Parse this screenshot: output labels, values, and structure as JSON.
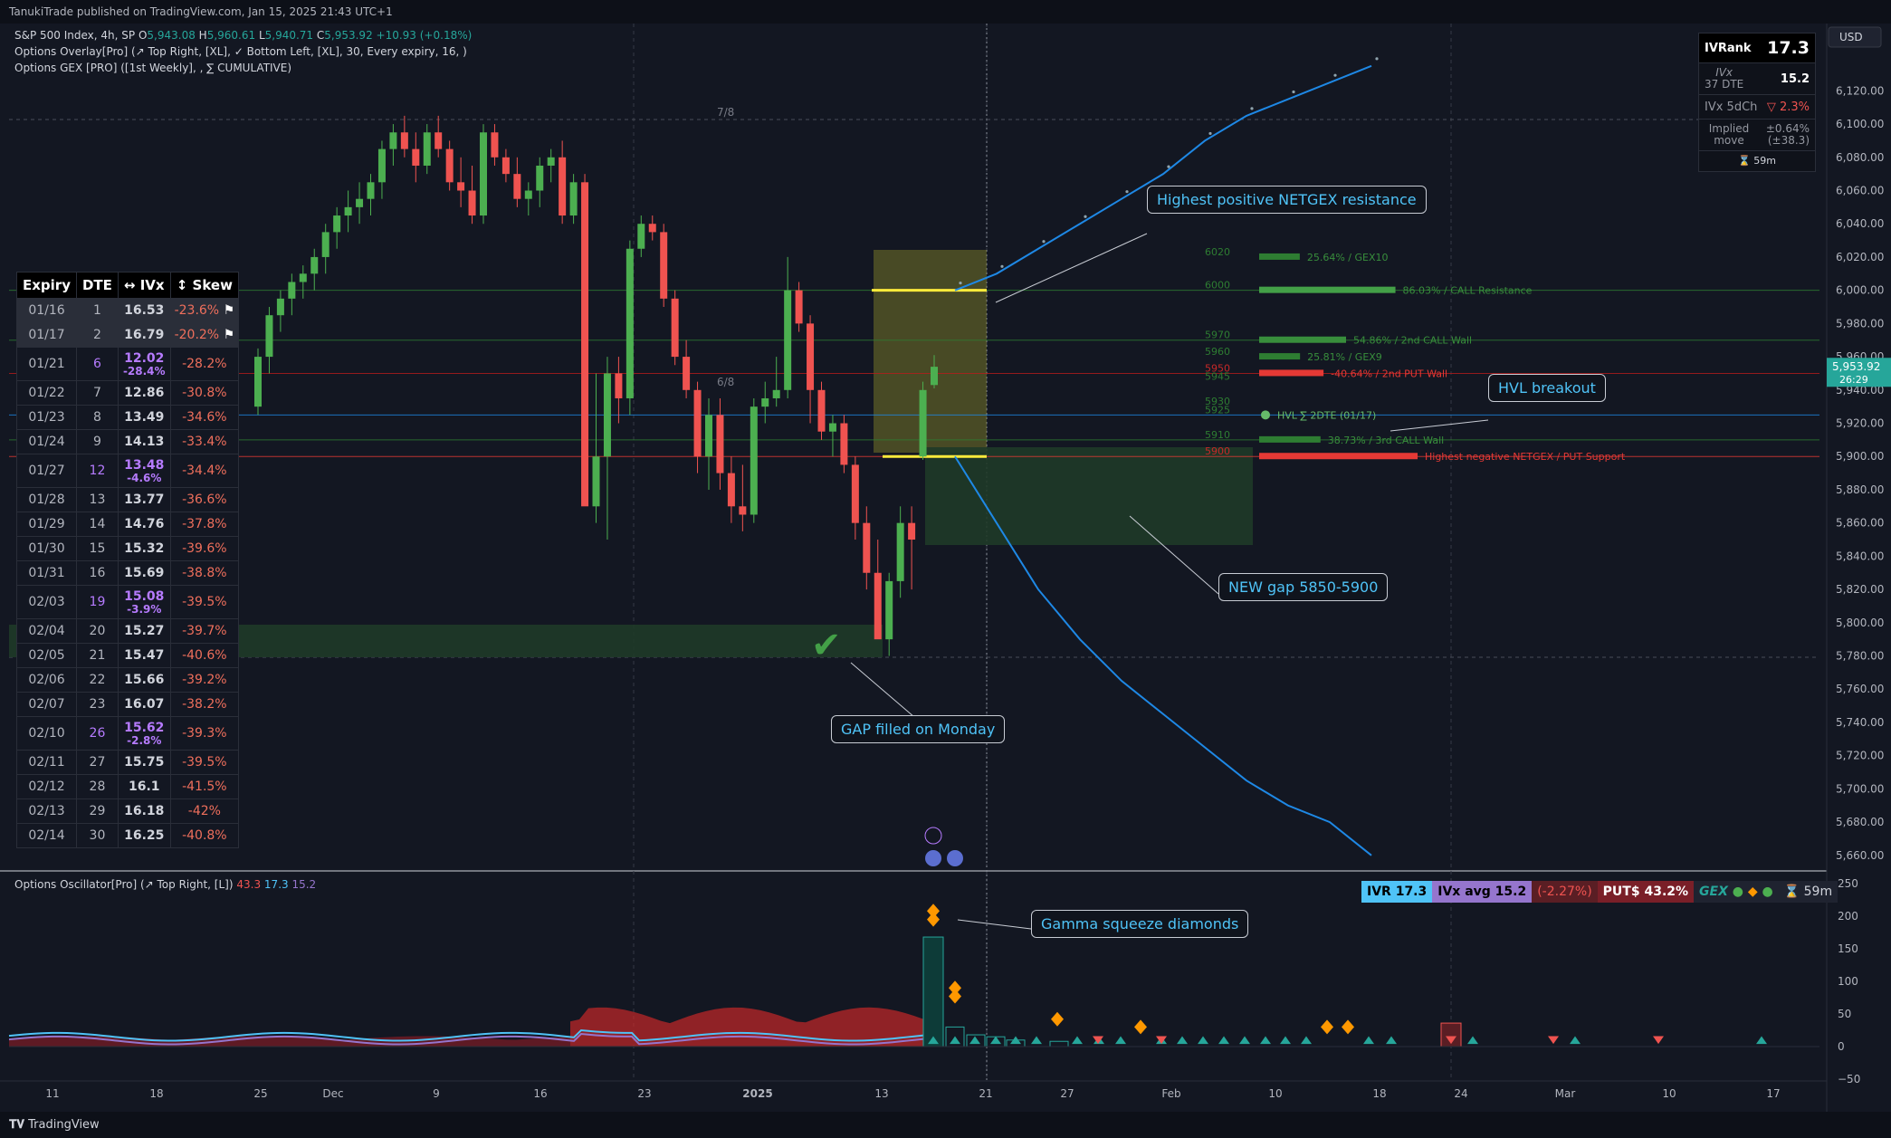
{
  "header": {
    "published": "TanukiTrade published on TradingView.com, Jan 15, 2025 21:43 UTC+1",
    "symbol": "S&P 500 Index, 4h, SP",
    "ohlc": {
      "o": "5,943.08",
      "h": "5,960.61",
      "l": "5,940.71",
      "c": "5,953.92",
      "change": "+10.93 (+0.18%)"
    },
    "overlay_line": "Options Overlay[Pro] (↗ Top Right, [XL], ✓ Bottom Left, [XL], 30, Every expiry, 16, )",
    "gex_line": "Options GEX [PRO] ([1st Weekly], , ∑ CUMULATIVE)"
  },
  "price_axis": {
    "currency": "USD",
    "ticks": [
      "6,120.00",
      "6,100.00",
      "6,080.00",
      "6,060.00",
      "6,040.00",
      "6,020.00",
      "6,000.00",
      "5,980.00",
      "5,960.00",
      "5,940.00",
      "5,920.00",
      "5,900.00",
      "5,880.00",
      "5,860.00",
      "5,840.00",
      "5,820.00",
      "5,800.00",
      "5,780.00",
      "5,760.00",
      "5,740.00",
      "5,720.00",
      "5,700.00",
      "5,680.00",
      "5,660.00"
    ],
    "current_price": "5,953.92",
    "countdown": "26:29"
  },
  "time_axis": {
    "labels": [
      "11",
      "18",
      "25",
      "Dec",
      "9",
      "16",
      "23",
      "2025",
      "13",
      "21",
      "27",
      "Feb",
      "10",
      "18",
      "24",
      "Mar",
      "10",
      "17"
    ]
  },
  "chart_data": {
    "type": "candlestick",
    "title": "S&P 500 Index, 4h",
    "ylim": [
      5655,
      6130
    ],
    "candles": [
      [
        5930,
        5965,
        5925,
        5960
      ],
      [
        5960,
        5990,
        5950,
        5985
      ],
      [
        5985,
        6000,
        5975,
        5995
      ],
      [
        5995,
        6010,
        5985,
        6005
      ],
      [
        6005,
        6015,
        5995,
        6010
      ],
      [
        6010,
        6025,
        6000,
        6020
      ],
      [
        6020,
        6040,
        6010,
        6035
      ],
      [
        6035,
        6050,
        6025,
        6045
      ],
      [
        6045,
        6060,
        6035,
        6050
      ],
      [
        6050,
        6065,
        6040,
        6055
      ],
      [
        6055,
        6070,
        6045,
        6065
      ],
      [
        6065,
        6090,
        6055,
        6085
      ],
      [
        6085,
        6100,
        6075,
        6095
      ],
      [
        6095,
        6105,
        6080,
        6085
      ],
      [
        6085,
        6095,
        6065,
        6075
      ],
      [
        6075,
        6100,
        6070,
        6095
      ],
      [
        6095,
        6105,
        6080,
        6085
      ],
      [
        6085,
        6090,
        6060,
        6065
      ],
      [
        6065,
        6080,
        6050,
        6060
      ],
      [
        6060,
        6075,
        6040,
        6045
      ],
      [
        6045,
        6100,
        6040,
        6095
      ],
      [
        6095,
        6100,
        6075,
        6080
      ],
      [
        6080,
        6085,
        6065,
        6070
      ],
      [
        6070,
        6080,
        6050,
        6055
      ],
      [
        6055,
        6065,
        6045,
        6060
      ],
      [
        6060,
        6080,
        6050,
        6075
      ],
      [
        6075,
        6085,
        6065,
        6080
      ],
      [
        6080,
        6090,
        6040,
        6045
      ],
      [
        6045,
        6070,
        6040,
        6065
      ],
      [
        6065,
        6070,
        6020,
        5870
      ],
      [
        5870,
        5950,
        5860,
        5900
      ],
      [
        5900,
        5960,
        5850,
        5950
      ],
      [
        5950,
        5960,
        5920,
        5935
      ],
      [
        5935,
        6030,
        5925,
        6025
      ],
      [
        6025,
        6045,
        6020,
        6040
      ],
      [
        6040,
        6045,
        6030,
        6035
      ],
      [
        6035,
        6040,
        5990,
        5995
      ],
      [
        5995,
        6000,
        5955,
        5960
      ],
      [
        5960,
        5970,
        5935,
        5940
      ],
      [
        5940,
        5945,
        5890,
        5900
      ],
      [
        5900,
        5935,
        5880,
        5925
      ],
      [
        5925,
        5935,
        5880,
        5890
      ],
      [
        5890,
        5900,
        5860,
        5870
      ],
      [
        5870,
        5895,
        5855,
        5865
      ],
      [
        5865,
        5935,
        5860,
        5930
      ],
      [
        5930,
        5945,
        5920,
        5935
      ],
      [
        5935,
        5960,
        5930,
        5940
      ],
      [
        5940,
        6020,
        5935,
        6000
      ],
      [
        6000,
        6005,
        5975,
        5980
      ],
      [
        5980,
        5985,
        5920,
        5940
      ],
      [
        5940,
        5945,
        5910,
        5915
      ],
      [
        5915,
        5925,
        5900,
        5920
      ],
      [
        5920,
        5925,
        5890,
        5895
      ],
      [
        5895,
        5900,
        5850,
        5860
      ],
      [
        5860,
        5870,
        5820,
        5830
      ],
      [
        5830,
        5850,
        5800,
        5790
      ],
      [
        5790,
        5830,
        5780,
        5825
      ],
      [
        5825,
        5870,
        5815,
        5860
      ],
      [
        5860,
        5870,
        5820,
        5850
      ],
      [
        5900,
        5945,
        5898,
        5940
      ],
      [
        5943,
        5961,
        5941,
        5954
      ]
    ],
    "levels": [
      {
        "strike": "6020",
        "label": "25.64% / GEX10",
        "value": 25.64,
        "color": "#2e7d32"
      },
      {
        "strike": "6000",
        "label": "86.03% / CALL Resistance",
        "value": 86.03,
        "color": "#43a047"
      },
      {
        "strike": "5970",
        "label": "54.86% / 2nd CALL Wall",
        "value": 54.86,
        "color": "#388e3c"
      },
      {
        "strike": "5960",
        "label": "25.81% / GEX9",
        "value": 25.81,
        "color": "#2e7d32"
      },
      {
        "strike": "5950",
        "label": "-40.64% / 2nd PUT Wall",
        "value": -40.64,
        "color": "#e53935"
      },
      {
        "strike": "5945",
        "label": "",
        "value": 0,
        "color": "#2e7d32"
      },
      {
        "strike": "5930",
        "label": "",
        "value": 0,
        "color": "#2e7d32"
      },
      {
        "strike": "5925",
        "label": "HVL ∑ 2DTE (01/17)",
        "value": 0,
        "color": "#66bb6a"
      },
      {
        "strike": "5910",
        "label": "38.73% / 3rd CALL Wall",
        "value": 38.73,
        "color": "#2e7d32"
      },
      {
        "strike": "5900",
        "label": "Highest negative NETGEX / PUT Support",
        "value": -100,
        "color": "#e53935"
      }
    ],
    "expected_move_upper": [
      6000,
      6010,
      6025,
      6040,
      6055,
      6070,
      6090,
      6105,
      6115,
      6125,
      6135
    ],
    "expected_move_lower": [
      5900,
      5860,
      5820,
      5790,
      5765,
      5745,
      5725,
      5705,
      5690,
      5680,
      5660
    ],
    "grid_labels": [
      "7/8",
      "6/8"
    ]
  },
  "expiry_table": {
    "headers": [
      "Expiry",
      "DTE",
      "↔ IVx",
      "↕ Skew"
    ],
    "rows": [
      {
        "expiry": "01/16",
        "dte": "1",
        "ivx": "16.53",
        "sub": "",
        "skew": "-23.6%",
        "icon": true,
        "sel": true,
        "hl": false
      },
      {
        "expiry": "01/17",
        "dte": "2",
        "ivx": "16.79",
        "sub": "",
        "skew": "-20.2%",
        "icon": true,
        "sel": true,
        "hl": false
      },
      {
        "expiry": "01/21",
        "dte": "6",
        "ivx": "12.02",
        "sub": "-28.4%",
        "skew": "-28.2%",
        "icon": false,
        "sel": false,
        "hl": true
      },
      {
        "expiry": "01/22",
        "dte": "7",
        "ivx": "12.86",
        "sub": "",
        "skew": "-30.8%",
        "icon": false,
        "sel": false,
        "hl": false
      },
      {
        "expiry": "01/23",
        "dte": "8",
        "ivx": "13.49",
        "sub": "",
        "skew": "-34.6%",
        "icon": false,
        "sel": false,
        "hl": false
      },
      {
        "expiry": "01/24",
        "dte": "9",
        "ivx": "14.13",
        "sub": "",
        "skew": "-33.4%",
        "icon": false,
        "sel": false,
        "hl": false
      },
      {
        "expiry": "01/27",
        "dte": "12",
        "ivx": "13.48",
        "sub": "-4.6%",
        "skew": "-34.4%",
        "icon": false,
        "sel": false,
        "hl": true
      },
      {
        "expiry": "01/28",
        "dte": "13",
        "ivx": "13.77",
        "sub": "",
        "skew": "-36.6%",
        "icon": false,
        "sel": false,
        "hl": false
      },
      {
        "expiry": "01/29",
        "dte": "14",
        "ivx": "14.76",
        "sub": "",
        "skew": "-37.8%",
        "icon": false,
        "sel": false,
        "hl": false
      },
      {
        "expiry": "01/30",
        "dte": "15",
        "ivx": "15.32",
        "sub": "",
        "skew": "-39.6%",
        "icon": false,
        "sel": false,
        "hl": false
      },
      {
        "expiry": "01/31",
        "dte": "16",
        "ivx": "15.69",
        "sub": "",
        "skew": "-38.8%",
        "icon": false,
        "sel": false,
        "hl": false
      },
      {
        "expiry": "02/03",
        "dte": "19",
        "ivx": "15.08",
        "sub": "-3.9%",
        "skew": "-39.5%",
        "icon": false,
        "sel": false,
        "hl": true
      },
      {
        "expiry": "02/04",
        "dte": "20",
        "ivx": "15.27",
        "sub": "",
        "skew": "-39.7%",
        "icon": false,
        "sel": false,
        "hl": false
      },
      {
        "expiry": "02/05",
        "dte": "21",
        "ivx": "15.47",
        "sub": "",
        "skew": "-40.6%",
        "icon": false,
        "sel": false,
        "hl": false
      },
      {
        "expiry": "02/06",
        "dte": "22",
        "ivx": "15.66",
        "sub": "",
        "skew": "-39.2%",
        "icon": false,
        "sel": false,
        "hl": false
      },
      {
        "expiry": "02/07",
        "dte": "23",
        "ivx": "16.07",
        "sub": "",
        "skew": "-38.2%",
        "icon": false,
        "sel": false,
        "hl": false
      },
      {
        "expiry": "02/10",
        "dte": "26",
        "ivx": "15.62",
        "sub": "-2.8%",
        "skew": "-39.3%",
        "icon": false,
        "sel": false,
        "hl": true
      },
      {
        "expiry": "02/11",
        "dte": "27",
        "ivx": "15.75",
        "sub": "",
        "skew": "-39.5%",
        "icon": false,
        "sel": false,
        "hl": false
      },
      {
        "expiry": "02/12",
        "dte": "28",
        "ivx": "16.1",
        "sub": "",
        "skew": "-41.5%",
        "icon": false,
        "sel": false,
        "hl": false
      },
      {
        "expiry": "02/13",
        "dte": "29",
        "ivx": "16.18",
        "sub": "",
        "skew": "-42%",
        "icon": false,
        "sel": false,
        "hl": false
      },
      {
        "expiry": "02/14",
        "dte": "30",
        "ivx": "16.25",
        "sub": "",
        "skew": "-40.8%",
        "icon": false,
        "sel": false,
        "hl": false
      }
    ]
  },
  "ivr_panel": {
    "ivrank_label": "IVRank",
    "ivrank_value": "17.3",
    "ivx_label": "IVx",
    "ivx_sub": "37 DTE",
    "ivx_value": "15.2",
    "ivx5d_label": "IVx 5dCh",
    "ivx5d_value": "▽ 2.3%",
    "implied_label": "Implied move",
    "implied_value": "±0.64% (±38.3)",
    "timer": "⌛ 59m"
  },
  "callouts": {
    "netgex": "Highest positive NETGEX resistance",
    "hvl": "HVL breakout",
    "gap": "NEW gap 5850-5900",
    "filled": "GAP filled on Monday",
    "gamma": "Gamma squeeze diamonds"
  },
  "oscillator": {
    "legend": "Options Oscillator[Pro] (↗ Top Right, [L])",
    "legend_vals": [
      "43.3",
      "17.3",
      "15.2"
    ],
    "axis_ticks": [
      "250",
      "200",
      "150",
      "100",
      "50",
      "0",
      "−50"
    ],
    "badges": {
      "ivr": "IVR 17.3",
      "ivx": "IVx avg 15.2",
      "chg": "(-2.27%)",
      "puts": "PUT$ 43.2%",
      "gex": "GEX",
      "timer": "⌛ 59m"
    }
  },
  "footer": {
    "brand": "TradingView"
  },
  "colors": {
    "bg": "#131722",
    "up": "#4caf50",
    "down": "#ef5350",
    "accent": "#4fc3f7",
    "hvl": "#66bb6a",
    "zone_yellow": "#8a8a2a",
    "zone_green": "#1f3a28"
  }
}
